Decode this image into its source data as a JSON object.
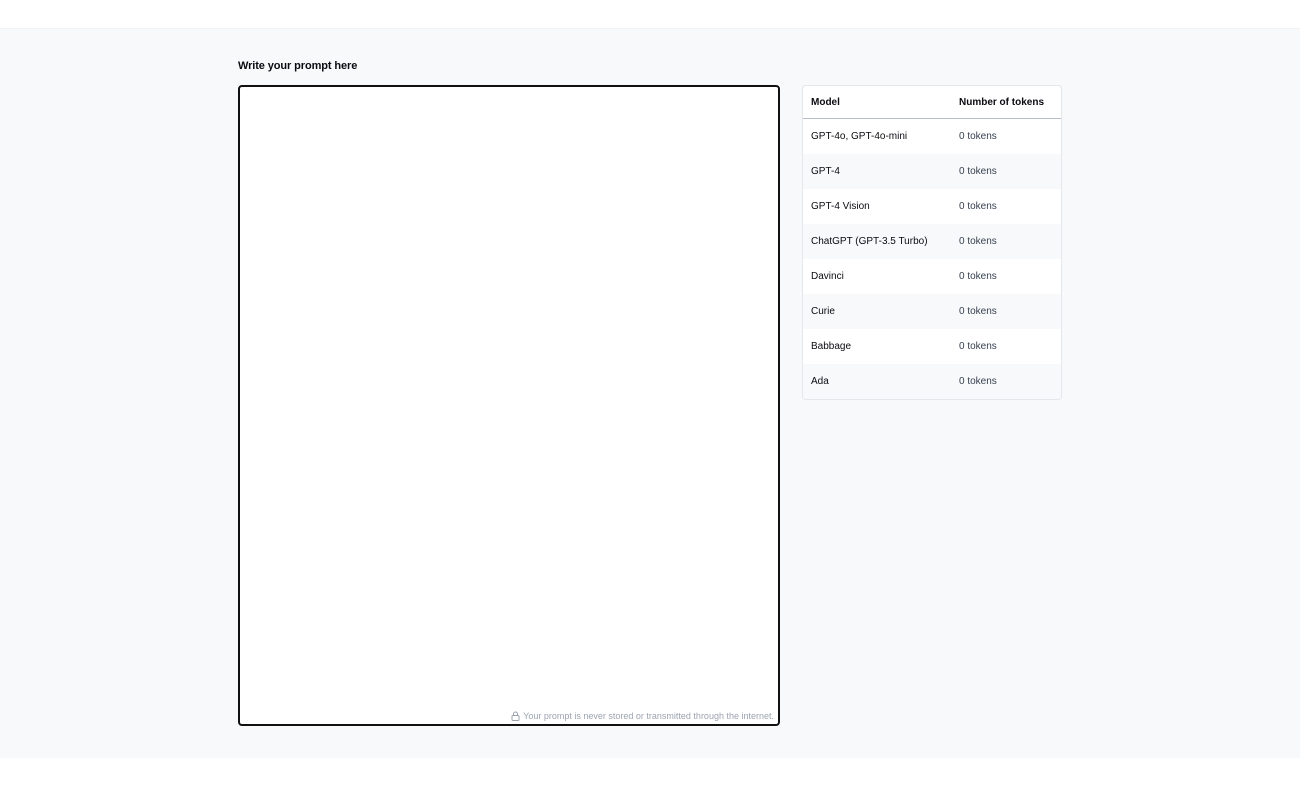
{
  "prompt": {
    "label": "Write your prompt here",
    "value": "",
    "placeholder": "",
    "privacy_note": "Your prompt is never stored or transmitted through the internet.",
    "privacy_icon": "lock-icon"
  },
  "token_table": {
    "headers": {
      "model": "Model",
      "tokens": "Number of tokens"
    },
    "rows": [
      {
        "model": "GPT-4o, GPT-4o-mini",
        "tokens": "0 tokens"
      },
      {
        "model": "GPT-4",
        "tokens": "0 tokens"
      },
      {
        "model": "GPT-4 Vision",
        "tokens": "0 tokens"
      },
      {
        "model": "ChatGPT (GPT-3.5 Turbo)",
        "tokens": "0 tokens"
      },
      {
        "model": "Davinci",
        "tokens": "0 tokens"
      },
      {
        "model": "Curie",
        "tokens": "0 tokens"
      },
      {
        "model": "Babbage",
        "tokens": "0 tokens"
      },
      {
        "model": "Ada",
        "tokens": "0 tokens"
      }
    ]
  },
  "colors": {
    "page_background": "#f8f9fa",
    "border_dark": "#111111",
    "muted_text": "#9ca3af"
  }
}
